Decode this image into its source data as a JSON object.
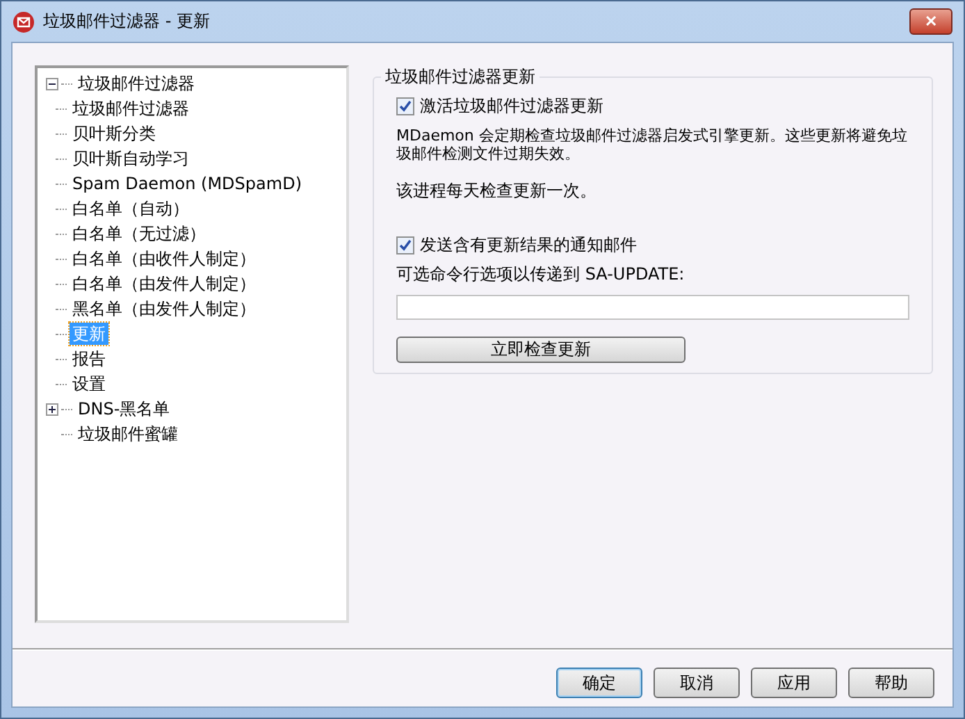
{
  "window": {
    "title": "垃圾邮件过滤器 - 更新",
    "close": "✕"
  },
  "tree": [
    {
      "label": "垃圾邮件过滤器",
      "expanded": true,
      "selected": false,
      "children": [
        {
          "label": "垃圾邮件过滤器",
          "selected": false
        },
        {
          "label": "贝叶斯分类",
          "selected": false
        },
        {
          "label": "贝叶斯自动学习",
          "selected": false
        },
        {
          "label": "Spam Daemon (MDSpamD)",
          "selected": false
        },
        {
          "label": "白名单（自动）",
          "selected": false
        },
        {
          "label": "白名单（无过滤）",
          "selected": false
        },
        {
          "label": "白名单（由收件人制定）",
          "selected": false
        },
        {
          "label": "白名单（由发件人制定）",
          "selected": false
        },
        {
          "label": "黑名单（由发件人制定）",
          "selected": false
        },
        {
          "label": "更新",
          "selected": true
        },
        {
          "label": "报告",
          "selected": false
        },
        {
          "label": "设置",
          "selected": false
        }
      ]
    },
    {
      "label": "DNS-黑名单",
      "expanded": false,
      "selected": false
    },
    {
      "label": "垃圾邮件蜜罐",
      "selected": false
    }
  ],
  "group": {
    "title": "垃圾邮件过滤器更新",
    "activate": {
      "label": "激活垃圾邮件过滤器更新",
      "checked": true
    },
    "description": "MDaemon 会定期检查垃圾邮件过滤器启发式引擎更新。这些更新将避免垃圾邮件检测文件过期失效。",
    "note": "该进程每天检查更新一次。",
    "notify": {
      "label": "发送含有更新结果的通知邮件",
      "checked": true
    },
    "options_label": "可选命令行选项以传递到 SA-UPDATE:",
    "check_button": "立即检查更新"
  },
  "buttons": [
    {
      "label": "确定",
      "default": true
    },
    {
      "label": "取消",
      "default": false
    },
    {
      "label": "应用",
      "default": false
    },
    {
      "label": "帮助",
      "default": false
    }
  ]
}
